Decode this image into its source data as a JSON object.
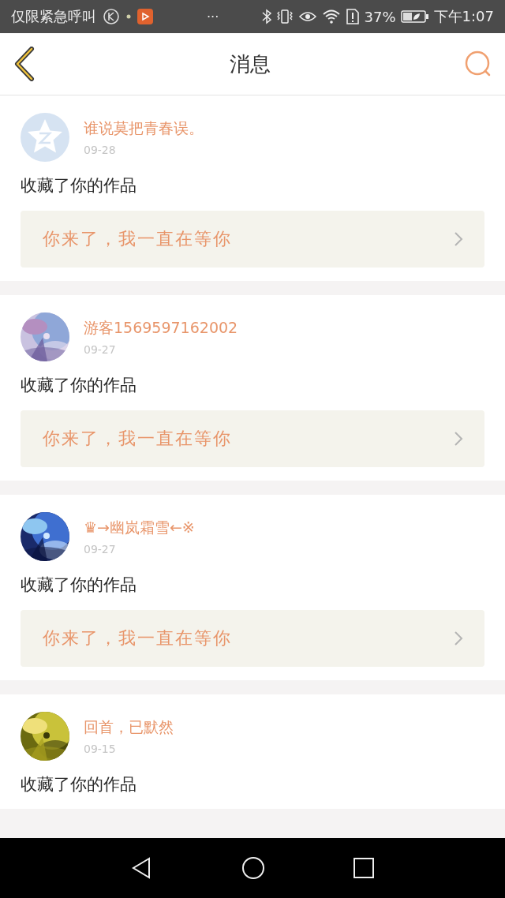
{
  "status_bar": {
    "carrier": "仅限紧急呼叫",
    "more": "···",
    "battery_percent": "37%",
    "time": "下午1:07"
  },
  "header": {
    "title": "消息"
  },
  "messages": [
    {
      "avatar": {
        "kind": "default"
      },
      "name": "谁说莫把青春误。",
      "date": "09-28",
      "action": "收藏了你的作品",
      "quote": "你来了，我一直在等你"
    },
    {
      "name": "游客1569597162002",
      "date": "09-27",
      "action": "收藏了你的作品",
      "quote": "你来了，我一直在等你"
    },
    {
      "name": "♛→幽岚霜雪←※",
      "date": "09-27",
      "action": "收藏了你的作品",
      "quote": "你来了，我一直在等你"
    },
    {
      "name": "回首，已默然",
      "date": "09-15",
      "action": "收藏了你的作品"
    }
  ]
}
